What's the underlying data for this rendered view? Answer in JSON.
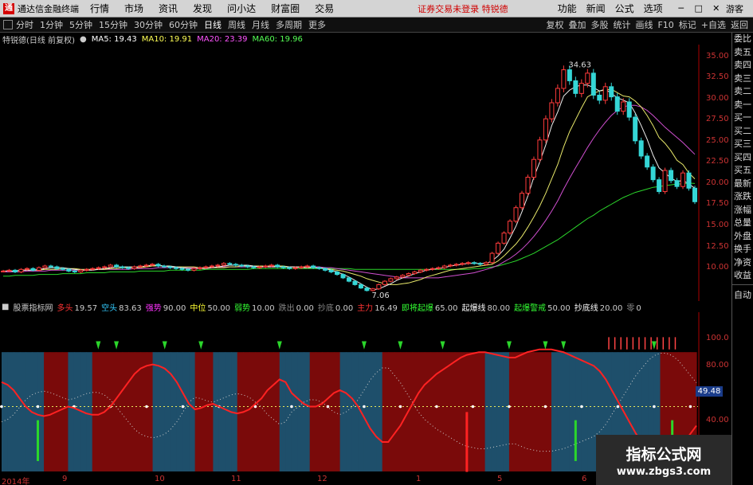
{
  "menubar": {
    "app_title": "通达信金融终端",
    "items": [
      "行情",
      "市场",
      "资讯",
      "发现",
      "问小达",
      "财富圈",
      "交易"
    ],
    "notice": "证券交易未登录 特锐德",
    "right_items": [
      "功能",
      "新闻",
      "公式",
      "选项"
    ],
    "guest": "游客"
  },
  "toolbar": {
    "periods": [
      "分时",
      "1分钟",
      "5分钟",
      "15分钟",
      "30分钟",
      "60分钟",
      "日线",
      "周线",
      "月线",
      "多周期",
      "更多"
    ],
    "active_period": "日线",
    "right": [
      "复权",
      "叠加",
      "多股",
      "统计",
      "画线",
      "F10",
      "标记",
      "+自选",
      "返回"
    ]
  },
  "price_chart": {
    "stock_label": "特锐德(日线 前复权)",
    "ma": [
      {
        "label": "MA5: 19.43",
        "color": "#ffffff"
      },
      {
        "label": "MA10: 19.91",
        "color": "#ffff55"
      },
      {
        "label": "MA20: 23.39",
        "color": "#ff55ff"
      },
      {
        "label": "MA60: 19.96",
        "color": "#55ff55"
      }
    ],
    "y_ticks": [
      "35.00",
      "32.50",
      "30.00",
      "27.50",
      "25.00",
      "22.50",
      "20.00",
      "17.50",
      "15.00",
      "12.50",
      "10.00"
    ],
    "high_label": "34.63",
    "low_label": "7.06"
  },
  "chart_data": {
    "type": "line",
    "ylim": [
      7,
      36
    ],
    "close": [
      9.6,
      9.7,
      9.5,
      9.8,
      9.9,
      9.7,
      10.0,
      10.2,
      10.1,
      9.9,
      9.8,
      9.6,
      9.5,
      9.7,
      9.8,
      9.9,
      10.0,
      10.1,
      10.3,
      10.1,
      10.0,
      9.9,
      10.1,
      10.2,
      10.3,
      10.4,
      10.2,
      10.1,
      10.0,
      9.9,
      9.8,
      9.7,
      9.9,
      10.0,
      10.1,
      10.2,
      10.3,
      10.5,
      10.4,
      10.3,
      10.2,
      10.1,
      10.0,
      10.1,
      10.2,
      10.3,
      10.1,
      10.0,
      9.9,
      10.0,
      10.1,
      10.2,
      10.0,
      9.9,
      9.7,
      9.5,
      9.2,
      8.8,
      8.4,
      8.0,
      7.6,
      7.3,
      7.5,
      8.0,
      8.4,
      8.7,
      8.9,
      9.1,
      9.3,
      9.5,
      9.7,
      9.8,
      9.9,
      10.0,
      10.2,
      10.3,
      10.4,
      10.5,
      10.6,
      10.5,
      10.4,
      10.6,
      11.7,
      12.9,
      14.1,
      15.5,
      17.1,
      18.8,
      20.7,
      22.8,
      25.1,
      27.6,
      29.5,
      31.2,
      33.4,
      32.1,
      30.6,
      31.8,
      33.0,
      30.4,
      29.8,
      31.4,
      30.2,
      28.5,
      29.6,
      27.8,
      25.0,
      23.2,
      21.9,
      20.4,
      19.0,
      21.5,
      20.3,
      19.6,
      21.2,
      19.4,
      17.8
    ],
    "ma5": [
      9.6,
      9.6,
      9.6,
      9.7,
      9.7,
      9.7,
      9.8,
      9.9,
      10.0,
      10.0,
      10.0,
      9.9,
      9.8,
      9.7,
      9.7,
      9.7,
      9.8,
      9.9,
      10.0,
      10.1,
      10.1,
      10.1,
      10.1,
      10.1,
      10.2,
      10.3,
      10.3,
      10.2,
      10.2,
      10.1,
      10.0,
      9.9,
      9.9,
      9.9,
      9.9,
      10.0,
      10.1,
      10.2,
      10.3,
      10.3,
      10.3,
      10.3,
      10.2,
      10.1,
      10.1,
      10.1,
      10.1,
      10.1,
      10.1,
      10.1,
      10.0,
      10.0,
      10.0,
      10.0,
      9.9,
      9.7,
      9.5,
      9.2,
      8.9,
      8.5,
      8.1,
      7.7,
      7.4,
      7.5,
      7.8,
      8.1,
      8.5,
      8.8,
      9.0,
      9.3,
      9.5,
      9.7,
      9.8,
      9.9,
      10.0,
      10.2,
      10.3,
      10.4,
      10.5,
      10.5,
      10.5,
      10.5,
      10.8,
      11.4,
      12.2,
      13.5,
      14.9,
      16.6,
      18.5,
      20.7,
      22.5,
      24.5,
      26.8,
      28.4,
      30.3,
      31.0,
      31.4,
      31.6,
      31.6,
      31.3,
      30.9,
      31.1,
      30.6,
      30.1,
      29.8,
      29.5,
      28.3,
      26.8,
      25.2,
      23.3,
      21.8,
      21.2,
      20.6,
      20.2,
      20.3,
      19.9,
      19.4
    ],
    "ma10": [
      9.6,
      9.6,
      9.6,
      9.7,
      9.7,
      9.7,
      9.7,
      9.8,
      9.8,
      9.8,
      9.9,
      9.9,
      9.9,
      9.8,
      9.8,
      9.8,
      9.8,
      9.8,
      9.9,
      9.9,
      10.0,
      10.0,
      10.0,
      10.0,
      10.1,
      10.2,
      10.2,
      10.2,
      10.1,
      10.1,
      10.1,
      10.1,
      10.1,
      10.0,
      10.0,
      10.0,
      10.0,
      10.0,
      10.1,
      10.1,
      10.2,
      10.2,
      10.2,
      10.2,
      10.2,
      10.2,
      10.2,
      10.2,
      10.1,
      10.1,
      10.1,
      10.1,
      10.0,
      10.0,
      9.9,
      9.8,
      9.7,
      9.6,
      9.4,
      9.2,
      9.0,
      8.7,
      8.5,
      8.3,
      8.1,
      8.0,
      8.0,
      8.1,
      8.2,
      8.4,
      8.6,
      8.9,
      9.1,
      9.3,
      9.5,
      9.7,
      9.8,
      9.9,
      10.0,
      10.1,
      10.2,
      10.3,
      10.4,
      10.8,
      11.4,
      12.1,
      12.8,
      13.7,
      14.8,
      16.0,
      17.3,
      18.8,
      20.5,
      22.2,
      24.3,
      26.1,
      27.5,
      28.9,
      30.2,
      30.6,
      30.9,
      31.0,
      31.1,
      30.7,
      30.3,
      30.2,
      29.7,
      29.0,
      28.0,
      26.8,
      25.4,
      24.7,
      23.8,
      22.7,
      22.2,
      21.2,
      20.5
    ],
    "ma20": [
      9.5,
      9.5,
      9.5,
      9.5,
      9.6,
      9.6,
      9.6,
      9.6,
      9.7,
      9.7,
      9.7,
      9.7,
      9.7,
      9.7,
      9.7,
      9.8,
      9.8,
      9.8,
      9.8,
      9.8,
      9.8,
      9.8,
      9.9,
      9.9,
      9.9,
      9.9,
      10.0,
      10.0,
      10.0,
      10.0,
      10.0,
      10.0,
      10.0,
      10.0,
      10.0,
      10.0,
      10.1,
      10.1,
      10.1,
      10.1,
      10.1,
      10.1,
      10.1,
      10.1,
      10.1,
      10.1,
      10.1,
      10.1,
      10.1,
      10.1,
      10.1,
      10.1,
      10.1,
      10.1,
      10.0,
      10.0,
      9.9,
      9.8,
      9.7,
      9.6,
      9.5,
      9.4,
      9.3,
      9.2,
      9.1,
      9.0,
      8.9,
      8.8,
      8.8,
      8.8,
      8.8,
      8.8,
      8.8,
      8.8,
      8.9,
      9.0,
      9.1,
      9.2,
      9.3,
      9.4,
      9.6,
      9.8,
      10.0,
      10.3,
      10.7,
      11.1,
      11.6,
      12.2,
      12.9,
      13.7,
      14.6,
      15.6,
      16.7,
      17.9,
      19.3,
      20.6,
      21.8,
      23.0,
      24.2,
      25.3,
      26.3,
      27.2,
      28.0,
      28.6,
      29.0,
      29.2,
      29.2,
      29.0,
      28.6,
      28.0,
      27.3,
      26.6,
      26.0,
      25.4,
      24.8,
      24.1,
      23.4
    ],
    "ma60": [
      9.0,
      9.0,
      9.1,
      9.1,
      9.1,
      9.1,
      9.2,
      9.2,
      9.2,
      9.2,
      9.3,
      9.3,
      9.3,
      9.3,
      9.4,
      9.4,
      9.4,
      9.4,
      9.5,
      9.5,
      9.5,
      9.5,
      9.5,
      9.6,
      9.6,
      9.6,
      9.6,
      9.6,
      9.7,
      9.7,
      9.7,
      9.7,
      9.7,
      9.7,
      9.8,
      9.8,
      9.8,
      9.8,
      9.8,
      9.8,
      9.8,
      9.8,
      9.9,
      9.9,
      9.9,
      9.9,
      9.9,
      9.9,
      9.9,
      9.9,
      9.9,
      9.9,
      9.9,
      9.9,
      9.9,
      9.9,
      9.9,
      9.9,
      9.9,
      9.8,
      9.8,
      9.8,
      9.8,
      9.8,
      9.8,
      9.8,
      9.8,
      9.8,
      9.8,
      9.8,
      9.8,
      9.8,
      9.8,
      9.8,
      9.8,
      9.8,
      9.8,
      9.8,
      9.8,
      9.9,
      9.9,
      10.0,
      10.1,
      10.2,
      10.4,
      10.6,
      10.8,
      11.1,
      11.4,
      11.7,
      12.1,
      12.5,
      12.9,
      13.3,
      13.8,
      14.3,
      14.8,
      15.3,
      15.8,
      16.2,
      16.7,
      17.1,
      17.5,
      17.9,
      18.3,
      18.6,
      18.9,
      19.1,
      19.3,
      19.5,
      19.6,
      19.7,
      19.8,
      19.9,
      19.9,
      20.0,
      19.96
    ]
  },
  "indicator": {
    "name": "股票指标网",
    "items": [
      {
        "label": "多头",
        "value": "19.57",
        "color": "#ff3333"
      },
      {
        "label": "空头",
        "value": "83.63",
        "color": "#33ccff"
      },
      {
        "label": "强势",
        "value": "90.00",
        "color": "#ff33ff"
      },
      {
        "label": "中位",
        "value": "50.00",
        "color": "#ffff33"
      },
      {
        "label": "弱势",
        "value": "10.00",
        "color": "#33ff33"
      },
      {
        "label": "跌出",
        "value": "0.00",
        "color": "#888888"
      },
      {
        "label": "抄底",
        "value": "0.00",
        "color": "#888888"
      },
      {
        "label": "主力",
        "value": "16.49",
        "color": "#ff3333"
      },
      {
        "label": "即将起爆",
        "value": "65.00",
        "color": "#33ff33"
      },
      {
        "label": "起爆线",
        "value": "80.00",
        "color": "#ffffff"
      },
      {
        "label": "起爆警戒",
        "value": "50.00",
        "color": "#33ff33"
      },
      {
        "label": "抄底线",
        "value": "20.00",
        "color": "#ffffff"
      },
      {
        "label": "零",
        "value": "0",
        "color": "#888888"
      }
    ],
    "y_ticks": [
      "100.0",
      "80.00",
      "40.00",
      "20.00"
    ],
    "current_value": "49.48",
    "red_line": [
      68,
      66,
      62,
      56,
      50,
      46,
      44,
      43,
      44,
      46,
      48,
      50,
      49,
      47,
      45,
      44,
      44,
      46,
      50,
      56,
      62,
      68,
      74,
      78,
      80,
      81,
      80,
      78,
      74,
      68,
      60,
      52,
      48,
      49,
      51,
      52,
      50,
      48,
      46,
      45,
      46,
      48,
      52,
      56,
      62,
      66,
      70,
      68,
      60,
      56,
      52,
      50,
      50,
      52,
      56,
      60,
      62,
      60,
      56,
      50,
      42,
      34,
      28,
      24,
      24,
      30,
      36,
      44,
      52,
      60,
      66,
      70,
      74,
      77,
      80,
      83,
      86,
      88,
      89,
      90,
      90,
      89,
      88,
      87,
      86,
      86,
      88,
      90,
      91,
      92,
      92,
      92,
      91,
      90,
      88,
      86,
      84,
      82,
      80,
      76,
      70,
      62,
      54,
      46,
      38,
      30,
      24,
      18,
      14,
      12,
      12,
      14,
      18,
      24,
      30,
      36
    ]
  },
  "dates": [
    "2014年",
    "9",
    "10",
    "11",
    "12",
    "1",
    "5",
    "6"
  ],
  "quote_panel": {
    "labels": [
      "委比",
      "卖五",
      "卖四",
      "卖三",
      "卖二",
      "卖一",
      "买一",
      "买二",
      "买三",
      "买四",
      "买五",
      "最新",
      "涨跌",
      "涨幅",
      "总量",
      "外盘",
      "换手",
      "净资",
      "收益"
    ],
    "button": "自动"
  },
  "watermark": {
    "line1": "指标公式网",
    "line2": "www.zbgs3.com"
  }
}
